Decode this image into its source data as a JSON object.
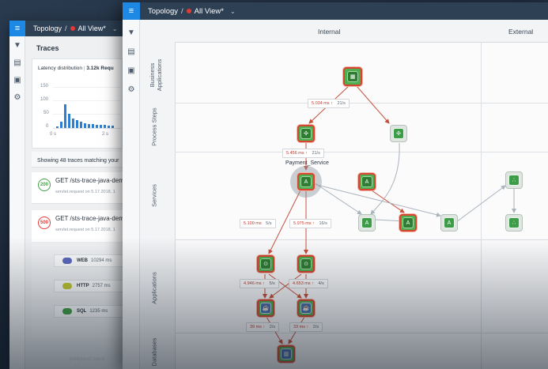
{
  "back_window": {
    "breadcrumb": {
      "section": "Topology",
      "sep": "/",
      "view": "All View*"
    },
    "rail_icons": [
      "filter-icon",
      "clipboard-icon",
      "panel-icon",
      "gear-icon"
    ],
    "title": "Traces",
    "histogram": {
      "label": "Latency distribution",
      "sep": "|",
      "requests": "3.12k Requ",
      "y_ticks": [
        "150",
        "100",
        "50",
        "0"
      ],
      "x_ticks": [
        "0 s",
        "2 s"
      ]
    },
    "showing": "Showing 48 traces matching your",
    "traces": [
      {
        "status": "200",
        "name": "GET /sts-trace-java-dem",
        "sub": "servlet.request on 5.17.2018, 1",
        "color": "#43a047"
      },
      {
        "status": "500",
        "name": "GET /sts-trace-java-dem",
        "sub": "servlet.request on 5.17.2018, 1",
        "color": "#e53935"
      }
    ],
    "spans": [
      {
        "label": "WEB",
        "ms": "10294 ms",
        "color": "#5c6bc0"
      },
      {
        "label": "HTTP",
        "ms": "2757 ms",
        "color": "#c0ca33"
      },
      {
        "label": "SQL",
        "ms": "1235 ms",
        "color": "#43a047"
      }
    ],
    "footer": "postgresql.query"
  },
  "front_window": {
    "breadcrumb": {
      "section": "Topology",
      "sep": "/",
      "view": "All View*"
    },
    "rail_icons": [
      "filter-icon",
      "clipboard-icon",
      "panel-icon",
      "gear-icon"
    ],
    "columns": [
      "Internal",
      "External"
    ],
    "rows": [
      "Business\nApplications",
      "Process Steps",
      "Services",
      "Applications",
      "Databases"
    ],
    "edge_labels": [
      {
        "ms": "5.034 ms",
        "rate": "21/s"
      },
      {
        "ms": "5.456 ms",
        "rate": "21/s"
      },
      {
        "ms": "5.100 ms",
        "rate": "5/s"
      },
      {
        "ms": "5.075 ms",
        "rate": "16/s"
      },
      {
        "ms": "4.946 ms",
        "rate": "5/s"
      },
      {
        "ms": "4.653 ms",
        "rate": "4/s"
      },
      {
        "ms": "39 ms",
        "rate": "2/s"
      },
      {
        "ms": "33 ms",
        "rate": "2/s"
      }
    ],
    "selected_service": "Payment_Service",
    "colors": {
      "accent": "#1e88e5",
      "topbar": "#2d4054",
      "alert": "#d6452f",
      "healthy": "#43a047"
    }
  }
}
